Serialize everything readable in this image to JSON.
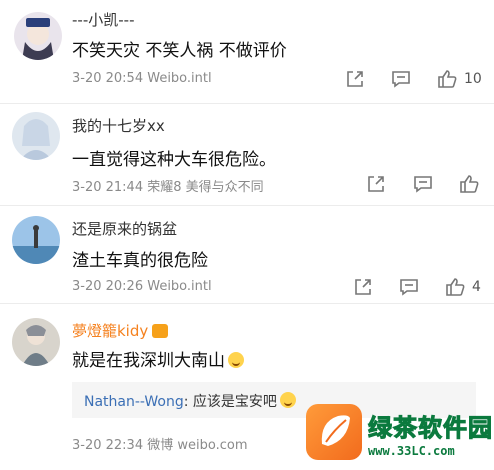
{
  "comments": [
    {
      "username": "---小凯---",
      "text": "不笑天灾  不笑人祸  不做评价",
      "meta": "3-20 20:54  Weibo.intl",
      "likes": "10"
    },
    {
      "username": "我的十七岁xx",
      "text": "一直觉得这种大车很危险。",
      "meta": "3-20 21:44  荣耀8 美得与众不同",
      "likes": ""
    },
    {
      "username": "还是原来的锅盆",
      "text": "渣土车真的很危险",
      "meta": "3-20 20:26  Weibo.intl",
      "likes": "4"
    },
    {
      "username": "夢燈籠kidy",
      "text": "就是在我深圳大南山",
      "meta": "3-20 22:34  微博 weibo.com",
      "likes": "",
      "reply": {
        "name": "Nathan--Wong",
        "text": ": 应该是宝安吧"
      }
    }
  ],
  "watermark": {
    "title": "绿茶软件园",
    "url": "www.33LC.com"
  },
  "colors": {
    "vip_name": "#f58220",
    "reply_name": "#3b6fb5",
    "meta": "#8a8a8a",
    "watermark_green": "#0b7a3e"
  },
  "icons": [
    "share-icon",
    "comment-icon",
    "like-icon"
  ]
}
